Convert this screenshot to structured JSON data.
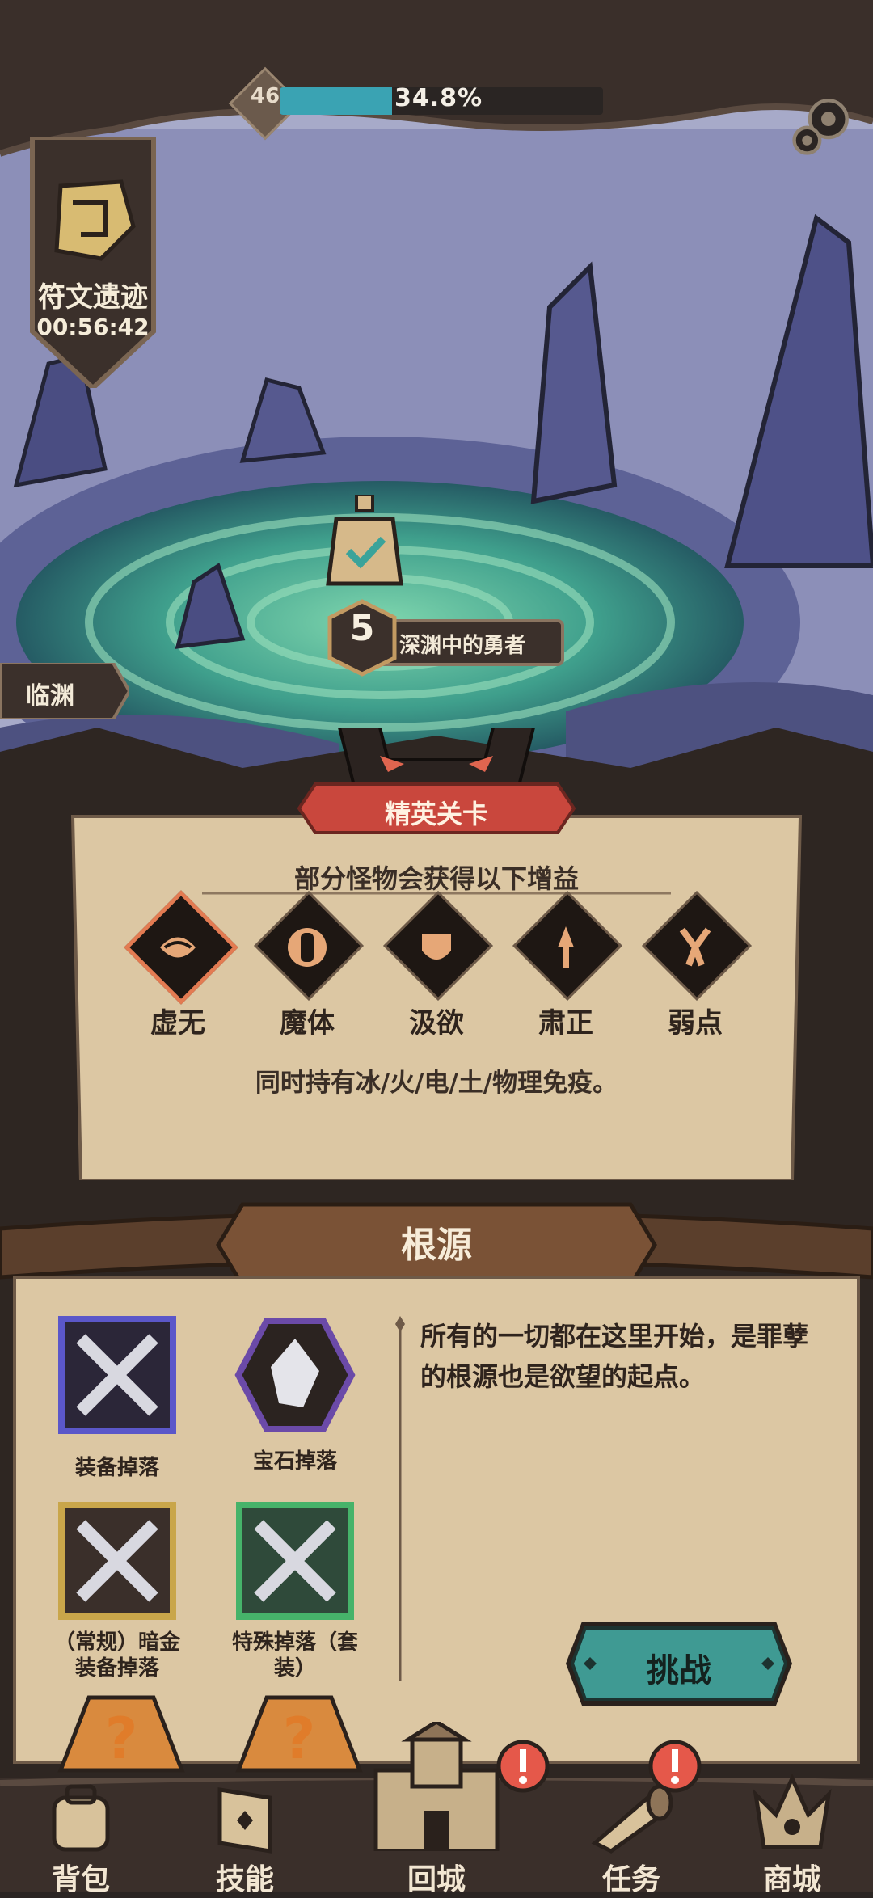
{
  "player": {
    "level": "46",
    "xp_percent_text": "34.8%",
    "xp_fraction": 0.348
  },
  "event": {
    "title": "符文遗迹",
    "timer": "00:56:42"
  },
  "map": {
    "stage_number": "5",
    "stage_name": "深渊中的勇者",
    "region_name": "临渊"
  },
  "elite": {
    "badge": "精英关卡",
    "subtitle": "部分怪物会获得以下增益",
    "buffs": [
      {
        "label": "虚无",
        "icon": "void-icon",
        "selected": true
      },
      {
        "label": "魔体",
        "icon": "demon-body-icon",
        "selected": false
      },
      {
        "label": "汲欲",
        "icon": "drain-desire-icon",
        "selected": false
      },
      {
        "label": "肃正",
        "icon": "purge-icon",
        "selected": false
      },
      {
        "label": "弱点",
        "icon": "weakness-icon",
        "selected": false
      }
    ],
    "description": "同时持有冰/火/电/土/物理免疫。"
  },
  "source": {
    "title": "根源",
    "description": "所有的一切都在这里开始，是罪孽的根源也是欲望的起点。",
    "drops": [
      {
        "label": "装备掉落",
        "icon": "equipment-drop-icon",
        "frame": "#5b57c9"
      },
      {
        "label": "宝石掉落",
        "icon": "gem-drop-icon",
        "frame": "#6b4aa8"
      },
      {
        "label": "（常规）暗金\n装备掉落",
        "icon": "dark-gold-equipment-icon",
        "frame": "#c9a64a"
      },
      {
        "label": "特殊掉落（套\n装）",
        "icon": "set-equipment-icon",
        "frame": "#46b36a"
      }
    ],
    "challenge_label": "挑战"
  },
  "nav": {
    "items": [
      {
        "label": "背包",
        "icon": "backpack-icon"
      },
      {
        "label": "技能",
        "icon": "skill-book-icon"
      },
      {
        "label": "回城",
        "icon": "castle-icon"
      },
      {
        "label": "任务",
        "icon": "quest-horn-icon"
      },
      {
        "label": "商城",
        "icon": "shop-crown-icon"
      }
    ]
  },
  "colors": {
    "xp_fill": "#3aa3b3",
    "elite_red": "#c9473d",
    "challenge_teal": "#3f9a93",
    "parchment": "#dcc7a3"
  }
}
